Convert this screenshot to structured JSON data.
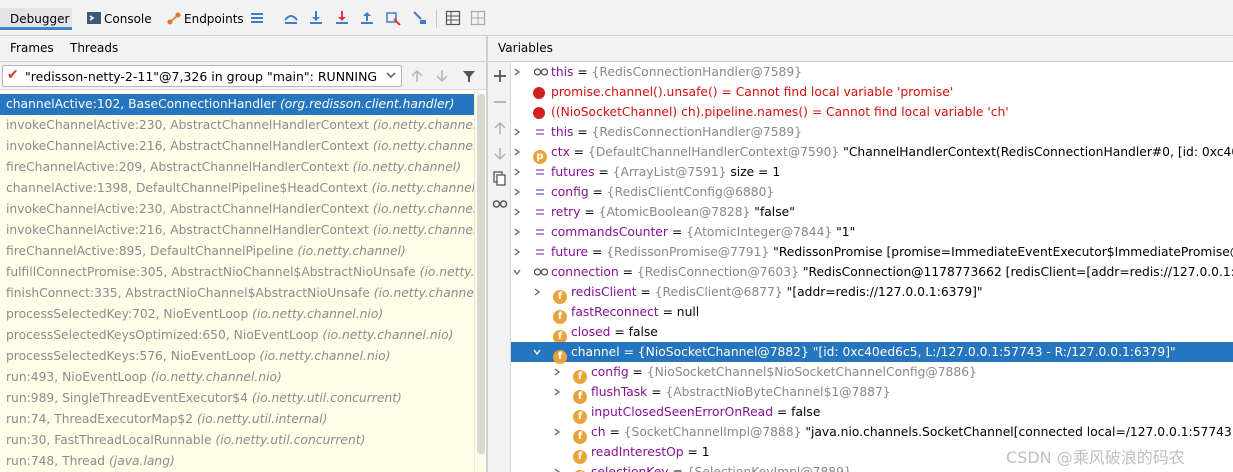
{
  "toolbar": {
    "debugger_tab": "Debugger",
    "console_tab": "Console",
    "endpoints_tab": "Endpoints"
  },
  "left_tabs": {
    "frames": "Frames",
    "threads": "Threads"
  },
  "right_header": {
    "variables": "Variables"
  },
  "thread_selector": {
    "value": "\"redisson-netty-2-11\"@7,326 in group \"main\": RUNNING"
  },
  "frames": [
    {
      "method": "channelActive:102, BaseConnectionHandler",
      "pkg": "(org.redisson.client.handler)",
      "selected": true
    },
    {
      "method": "invokeChannelActive:230, AbstractChannelHandlerContext",
      "pkg": "(io.netty.channel)"
    },
    {
      "method": "invokeChannelActive:216, AbstractChannelHandlerContext",
      "pkg": "(io.netty.channel)"
    },
    {
      "method": "fireChannelActive:209, AbstractChannelHandlerContext",
      "pkg": "(io.netty.channel)"
    },
    {
      "method": "channelActive:1398, DefaultChannelPipeline$HeadContext",
      "pkg": "(io.netty.channel)"
    },
    {
      "method": "invokeChannelActive:230, AbstractChannelHandlerContext",
      "pkg": "(io.netty.channel)"
    },
    {
      "method": "invokeChannelActive:216, AbstractChannelHandlerContext",
      "pkg": "(io.netty.channel)"
    },
    {
      "method": "fireChannelActive:895, DefaultChannelPipeline",
      "pkg": "(io.netty.channel)"
    },
    {
      "method": "fulfillConnectPromise:305, AbstractNioChannel$AbstractNioUnsafe",
      "pkg": "(io.netty.channel.nio)"
    },
    {
      "method": "finishConnect:335, AbstractNioChannel$AbstractNioUnsafe",
      "pkg": "(io.netty.channel.nio)"
    },
    {
      "method": "processSelectedKey:702, NioEventLoop",
      "pkg": "(io.netty.channel.nio)"
    },
    {
      "method": "processSelectedKeysOptimized:650, NioEventLoop",
      "pkg": "(io.netty.channel.nio)"
    },
    {
      "method": "processSelectedKeys:576, NioEventLoop",
      "pkg": "(io.netty.channel.nio)"
    },
    {
      "method": "run:493, NioEventLoop",
      "pkg": "(io.netty.channel.nio)"
    },
    {
      "method": "run:989, SingleThreadEventExecutor$4",
      "pkg": "(io.netty.util.concurrent)"
    },
    {
      "method": "run:74, ThreadExecutorMap$2",
      "pkg": "(io.netty.util.internal)"
    },
    {
      "method": "run:30, FastThreadLocalRunnable",
      "pkg": "(io.netty.util.concurrent)"
    },
    {
      "method": "run:748, Thread",
      "pkg": "(java.lang)"
    }
  ],
  "variables": [
    {
      "depth": 0,
      "expand": "right",
      "icon": "oo",
      "name": "this",
      "eq": " = ",
      "ref": "{RedisConnectionHandler@7589}",
      "val": ""
    },
    {
      "depth": 0,
      "expand": "",
      "icon": "err",
      "name": "promise.channel().unsafe()",
      "eq": " = ",
      "ref": "",
      "val": "Cannot find local variable 'promise'",
      "error": true
    },
    {
      "depth": 0,
      "expand": "",
      "icon": "err",
      "name": "((NioSocketChannel) ch).pipeline.names()",
      "eq": " = ",
      "ref": "",
      "val": "Cannot find local variable 'ch'",
      "error": true
    },
    {
      "depth": 0,
      "expand": "right",
      "icon": "eq",
      "name": "this",
      "eq": " = ",
      "ref": "{RedisConnectionHandler@7589}",
      "val": ""
    },
    {
      "depth": 0,
      "expand": "right",
      "icon": "p",
      "name": "ctx",
      "eq": " = ",
      "ref": "{DefaultChannelHandlerContext@7590}",
      "val": " \"ChannelHandlerContext(RedisConnectionHandler#0, [id: 0xc40ed6c5, L:/"
    },
    {
      "depth": 0,
      "expand": "right",
      "icon": "eq",
      "name": "futures",
      "eq": " = ",
      "ref": "{ArrayList@7591}",
      "val": "  size = 1"
    },
    {
      "depth": 0,
      "expand": "right",
      "icon": "eq",
      "name": "config",
      "eq": " = ",
      "ref": "{RedisClientConfig@6880}",
      "val": ""
    },
    {
      "depth": 0,
      "expand": "right",
      "icon": "eq",
      "name": "retry",
      "eq": " = ",
      "ref": "{AtomicBoolean@7828}",
      "val": " \"false\""
    },
    {
      "depth": 0,
      "expand": "right",
      "icon": "eq",
      "name": "commandsCounter",
      "eq": " = ",
      "ref": "{AtomicInteger@7844}",
      "val": " \"1\""
    },
    {
      "depth": 0,
      "expand": "right",
      "icon": "eq",
      "name": "future",
      "eq": " = ",
      "ref": "{RedissonPromise@7791}",
      "val": " \"RedissonPromise [promise=ImmediateEventExecutor$ImmediatePromise@489c20"
    },
    {
      "depth": 0,
      "expand": "down",
      "icon": "oo",
      "name": "connection",
      "eq": " = ",
      "ref": "{RedisConnection@7603}",
      "val": " \"RedisConnection@1178773662 [redisClient=[addr=redis://127.0.0.1:6379], ch"
    },
    {
      "depth": 1,
      "expand": "right",
      "icon": "f",
      "name": "redisClient",
      "eq": " = ",
      "ref": "{RedisClient@6877}",
      "val": " \"[addr=redis://127.0.0.1:6379]\""
    },
    {
      "depth": 1,
      "expand": "",
      "icon": "f",
      "name": "fastReconnect",
      "eq": " = ",
      "ref": "",
      "val": "null"
    },
    {
      "depth": 1,
      "expand": "",
      "icon": "f",
      "name": "closed",
      "eq": " = ",
      "ref": "",
      "val": "false"
    },
    {
      "depth": 1,
      "expand": "down",
      "icon": "f",
      "name": "channel",
      "eq": " = ",
      "ref": "{NioSocketChannel@7882}",
      "val": " \"[id: 0xc40ed6c5, L:/127.0.0.1:57743 - R:/127.0.0.1:6379]\"",
      "selected": true
    },
    {
      "depth": 2,
      "expand": "right",
      "icon": "f",
      "name": "config",
      "eq": " = ",
      "ref": "{NioSocketChannel$NioSocketChannelConfig@7886}",
      "val": ""
    },
    {
      "depth": 2,
      "expand": "right",
      "icon": "f",
      "name": "flushTask",
      "eq": " = ",
      "ref": "{AbstractNioByteChannel$1@7887}",
      "val": ""
    },
    {
      "depth": 2,
      "expand": "",
      "icon": "f",
      "name": "inputClosedSeenErrorOnRead",
      "eq": " = ",
      "ref": "",
      "val": "false"
    },
    {
      "depth": 2,
      "expand": "right",
      "icon": "f",
      "name": "ch",
      "eq": " = ",
      "ref": "{SocketChannelImpl@7888}",
      "val": " \"java.nio.channels.SocketChannel[connected local=/127.0.0.1:57743 remote=/"
    },
    {
      "depth": 2,
      "expand": "",
      "icon": "f",
      "name": "readInterestOp",
      "eq": " = ",
      "ref": "",
      "val": "1"
    },
    {
      "depth": 2,
      "expand": "right",
      "icon": "f",
      "name": "selectionKey",
      "eq": " = ",
      "ref": "{SelectionKeyImpl@7889}",
      "val": ""
    }
  ],
  "watermark": "CSDN @乘风破浪的码农",
  "colors": {
    "selection": "#2675bf",
    "frames_bg": "#fdfde8",
    "error": "#d01010",
    "field_badge": "#e8a33d",
    "tab_underline": "#4083c9"
  }
}
